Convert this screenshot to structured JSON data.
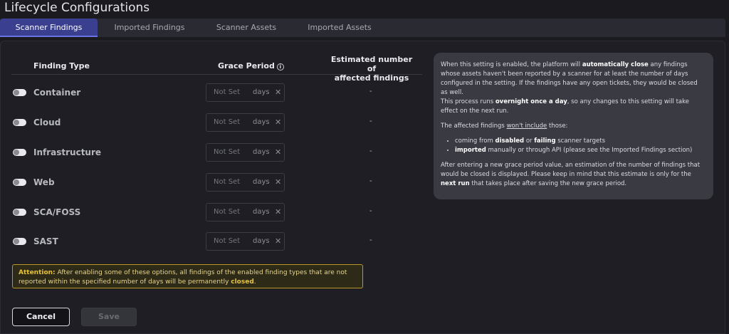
{
  "page": {
    "title": "Lifecycle Configurations"
  },
  "tabs": [
    {
      "label": "Scanner Findings",
      "active": true
    },
    {
      "label": "Imported Findings",
      "active": false
    },
    {
      "label": "Scanner Assets",
      "active": false
    },
    {
      "label": "Imported Assets",
      "active": false
    }
  ],
  "table": {
    "headers": {
      "finding_type": "Finding Type",
      "grace_period": "Grace Period",
      "estimated_line1": "Estimated number of",
      "estimated_line2": "affected findings"
    },
    "rows": [
      {
        "label": "Container",
        "placeholder": "Not Set",
        "unit": "days",
        "clear": "✕",
        "estimate": "-",
        "enabled": false
      },
      {
        "label": "Cloud",
        "placeholder": "Not Set",
        "unit": "days",
        "clear": "✕",
        "estimate": "-",
        "enabled": false
      },
      {
        "label": "Infrastructure",
        "placeholder": "Not Set",
        "unit": "days",
        "clear": "✕",
        "estimate": "-",
        "enabled": false
      },
      {
        "label": "Web",
        "placeholder": "Not Set",
        "unit": "days",
        "clear": "✕",
        "estimate": "-",
        "enabled": false
      },
      {
        "label": "SCA/FOSS",
        "placeholder": "Not Set",
        "unit": "days",
        "clear": "✕",
        "estimate": "-",
        "enabled": false
      },
      {
        "label": "SAST",
        "placeholder": "Not Set",
        "unit": "days",
        "clear": "✕",
        "estimate": "-",
        "enabled": false
      }
    ]
  },
  "attention": {
    "label": "Attention:",
    "text_a": " After enabling some of these options, all findings of the enabled finding types that are not reported within the specified number of days will be permanently ",
    "strong": "closed",
    "text_b": "."
  },
  "buttons": {
    "cancel": "Cancel",
    "save": "Save"
  },
  "info": {
    "p1_a": "When this setting is enabled, the platform will ",
    "p1_b": "automatically close",
    "p1_c": " any findings whose assets haven't been reported by a scanner for at least the number of days configured in the setting. If the findings have any open tickets, they would be closed as well.",
    "p1_d": "This process runs ",
    "p1_e": "overnight once a day",
    "p1_f": ", so any changes to this setting will take effect on the next run.",
    "p2_a": "The affected findings ",
    "p2_b": "won't include",
    "p2_c": " those:",
    "li1_a": "coming from ",
    "li1_b": "disabled",
    "li1_c": " or ",
    "li1_d": "failing",
    "li1_e": " scanner targets",
    "li2_a": "imported",
    "li2_b": " manually or through API (please see the Imported Findings section)",
    "p3_a": "After entering a new grace period value, an estimation of the number of findings that would be closed is displayed. Please keep in mind that this estimate is only for the ",
    "p3_b": "next run",
    "p3_c": " that takes place after saving the new grace period."
  },
  "colors": {
    "accent_tab": "#3a3f8f",
    "attention_border": "#b89628",
    "background": "#1a1a1f"
  }
}
